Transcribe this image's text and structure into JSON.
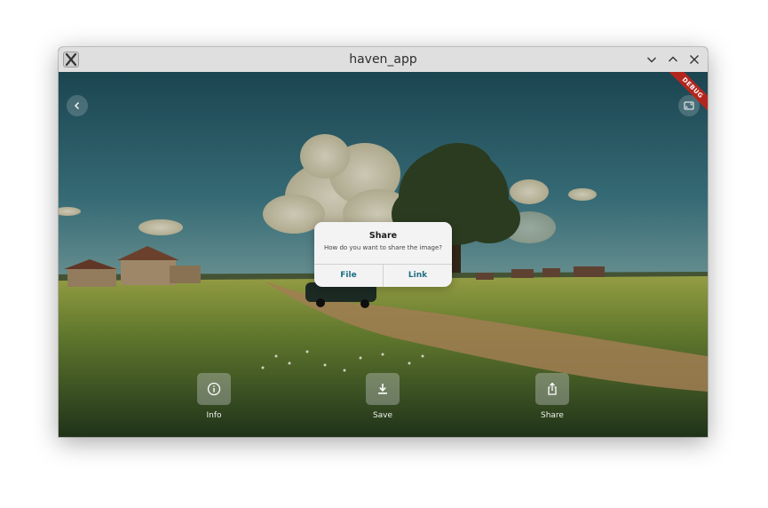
{
  "window": {
    "title": "haven_app"
  },
  "dialog": {
    "title": "Share",
    "message": "How do you want to share the image?",
    "file_label": "File",
    "link_label": "Link"
  },
  "actions": [
    {
      "label": "Info",
      "icon": "info-icon"
    },
    {
      "label": "Save",
      "icon": "download-icon"
    },
    {
      "label": "Share",
      "icon": "share-icon"
    }
  ],
  "debug_banner": "DEBUG",
  "colors": {
    "accent": "#1f6e83",
    "debug_banner": "#b3261e",
    "titlebar": "#dfdfdf"
  }
}
